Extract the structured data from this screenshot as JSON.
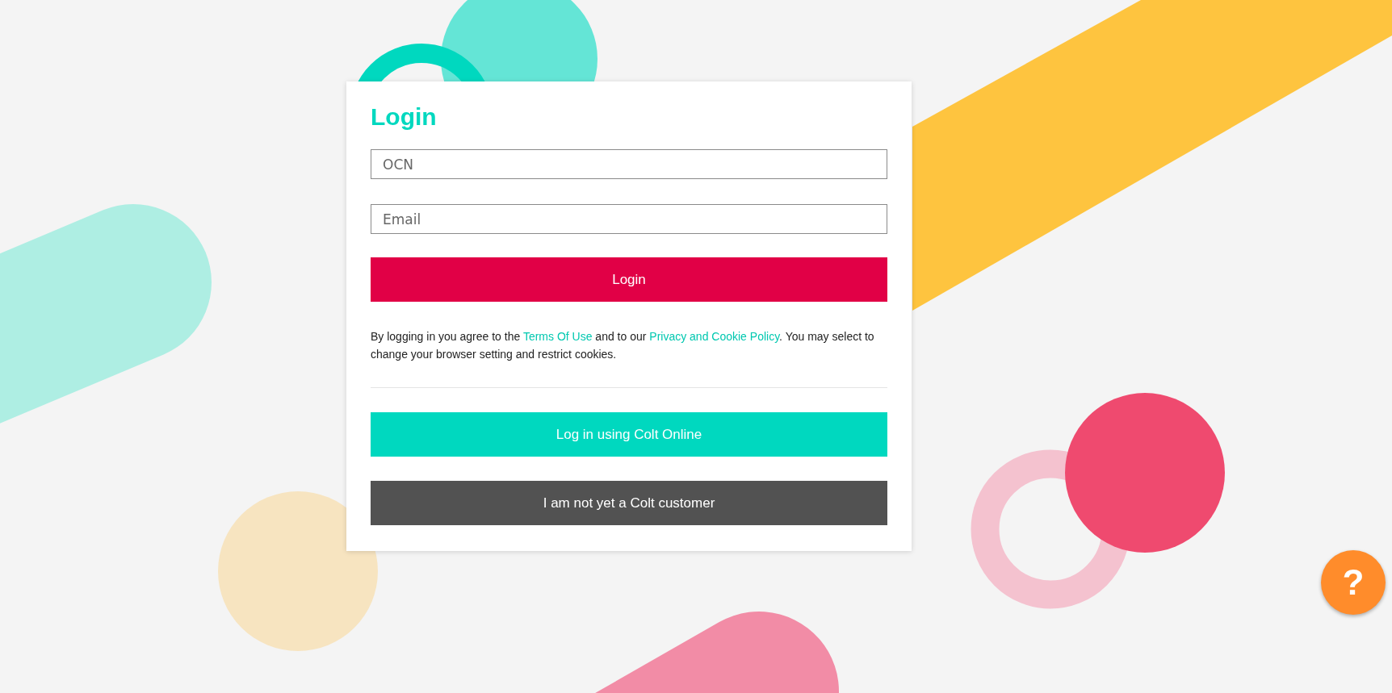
{
  "login_card": {
    "title": "Login",
    "fields": [
      {
        "placeholder": "OCN"
      },
      {
        "placeholder": "Email"
      }
    ],
    "login_button": "Login",
    "consent": [
      {
        "kind": "text",
        "text": "By logging in you agree to the "
      },
      {
        "kind": "link",
        "text": "Terms Of Use"
      },
      {
        "kind": "text",
        "text": " and to our "
      },
      {
        "kind": "link",
        "text": "Privacy and Cookie Policy"
      },
      {
        "kind": "text",
        "text": ". You may select to change your browser setting and restrict cookies."
      }
    ],
    "actions": [
      {
        "kind": "primary",
        "label": "Log in using Colt Online"
      },
      {
        "kind": "secondary",
        "label": "I am not yet a Colt customer"
      }
    ]
  },
  "help_button": {
    "label": "?"
  }
}
